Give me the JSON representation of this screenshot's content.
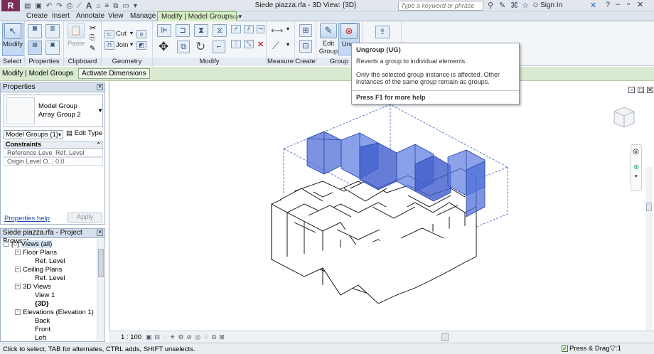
{
  "window": {
    "title": "Siede piazza.rfa - 3D View: {3D}",
    "search_placeholder": "Type a keyword or phrase",
    "sign_in": "Sign In",
    "app_letter": "R"
  },
  "tabs": [
    {
      "label": "Create"
    },
    {
      "label": "Insert"
    },
    {
      "label": "Annotate"
    },
    {
      "label": "View"
    },
    {
      "label": "Manage"
    },
    {
      "label": "Modify | Model Groups",
      "active": true
    }
  ],
  "ribbon": {
    "panels": {
      "select": "Select",
      "properties": "Properties",
      "clipboard": "Clipboard",
      "geometry": "Geometry",
      "modify": "Modify",
      "measure": "Measure",
      "create": "Create",
      "group": "Group"
    },
    "modify_button": "Modify",
    "paste_button": "Paste",
    "cut_button": "Cut",
    "join_button": "Join",
    "edit_group_line1": "Edit",
    "edit_group_line2": "Group",
    "ungroup_button": "Ungr"
  },
  "options_bar": {
    "context": "Modify | Model Groups",
    "activate_dimensions": "Activate Dimensions"
  },
  "tooltip": {
    "title": "Ungroup (UG)",
    "line1": "Reverts a group to individual elements.",
    "line2": "Only the selected group instance is affected. Other instances of the same group remain as groups.",
    "help": "Press F1 for more help"
  },
  "properties": {
    "header": "Properties",
    "type_family": "Model Group",
    "type_name": "Array Group 2",
    "selection_filter": "Model Groups (1)",
    "edit_type": "Edit Type",
    "section": "Constraints",
    "rows": [
      {
        "key": "Reference Level",
        "value": "Ref. Level"
      },
      {
        "key": "Origin Level O...",
        "value": "0.0"
      }
    ],
    "help_link": "Properties help",
    "apply": "Apply"
  },
  "project_browser": {
    "header": "Siede piazza.rfa - Project Browser",
    "items": [
      {
        "label": "Views (all)",
        "level": 0,
        "bold": false
      },
      {
        "label": "Floor Plans",
        "level": 1
      },
      {
        "label": "Ref. Level",
        "level": 2
      },
      {
        "label": "Ceiling Plans",
        "level": 1
      },
      {
        "label": "Ref. Level",
        "level": 2
      },
      {
        "label": "3D Views",
        "level": 1
      },
      {
        "label": "View 1",
        "level": 2
      },
      {
        "label": "{3D}",
        "level": 2,
        "bold": true
      },
      {
        "label": "Elevations (Elevation 1)",
        "level": 1
      },
      {
        "label": "Back",
        "level": 2
      },
      {
        "label": "Front",
        "level": 2
      },
      {
        "label": "Left",
        "level": 2
      }
    ]
  },
  "view": {
    "scale": "1 : 100",
    "selection_color": "#3b5fd6"
  },
  "status": {
    "text": "Click to select, TAB for alternates, CTRL adds, SHIFT unselects.",
    "press_drag": "Press & Drag",
    "filter_count": ":1"
  }
}
